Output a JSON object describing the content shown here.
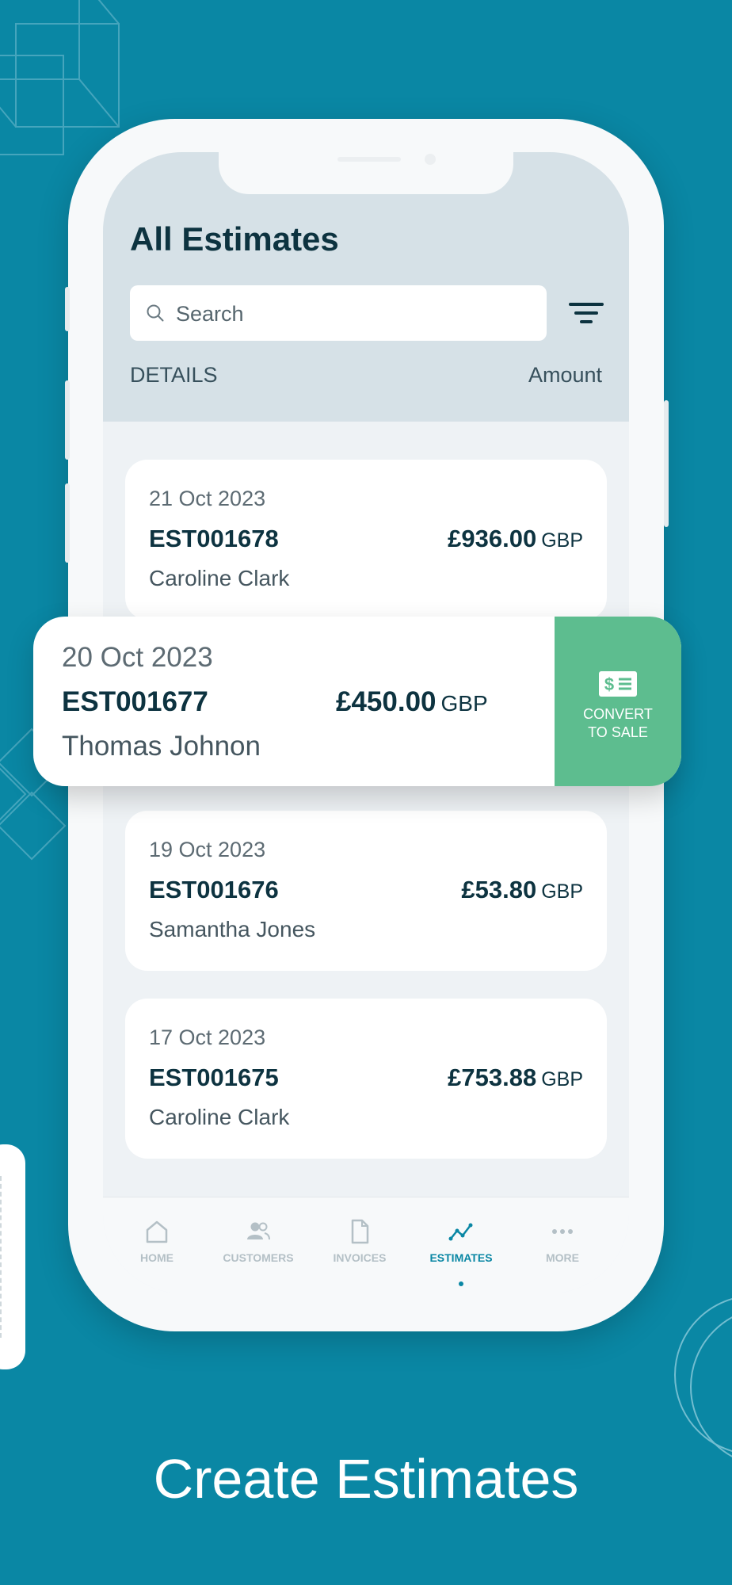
{
  "screen": {
    "title": "All Estimates",
    "search": {
      "placeholder": "Search",
      "value": ""
    },
    "columns": {
      "details": "DETAILS",
      "amount": "Amount"
    },
    "estimates": [
      {
        "date": "21 Oct 2023",
        "number": "EST001678",
        "amount": "£936.00",
        "currency": "GBP",
        "customer": "Caroline Clark"
      },
      {
        "date": "20 Oct 2023",
        "number": "EST001677",
        "amount": "£450.00",
        "currency": "GBP",
        "customer": "Thomas Johnon"
      },
      {
        "date": "19 Oct 2023",
        "number": "EST001676",
        "amount": "£53.80",
        "currency": "GBP",
        "customer": "Samantha Jones"
      },
      {
        "date": "17 Oct 2023",
        "number": "EST001675",
        "amount": "£753.88",
        "currency": "GBP",
        "customer": "Caroline Clark"
      }
    ],
    "swipe_action": {
      "label": "CONVERT\nTO SALE",
      "icon": "dollar-bill-icon",
      "color": "#5dbd8f"
    },
    "bottom_nav": [
      {
        "label": "HOME",
        "icon": "home-icon"
      },
      {
        "label": "CUSTOMERS",
        "icon": "customers-icon"
      },
      {
        "label": "INVOICES",
        "icon": "invoice-icon"
      },
      {
        "label": "ESTIMATES",
        "icon": "estimates-icon",
        "active": true
      },
      {
        "label": "MORE",
        "icon": "more-icon"
      }
    ]
  },
  "tagline": "Create Estimates",
  "colors": {
    "background": "#0a87a4",
    "header": "#d6e1e7",
    "accent": "#0a87a4",
    "text_dark": "#0d3340",
    "convert_green": "#5dbd8f"
  }
}
